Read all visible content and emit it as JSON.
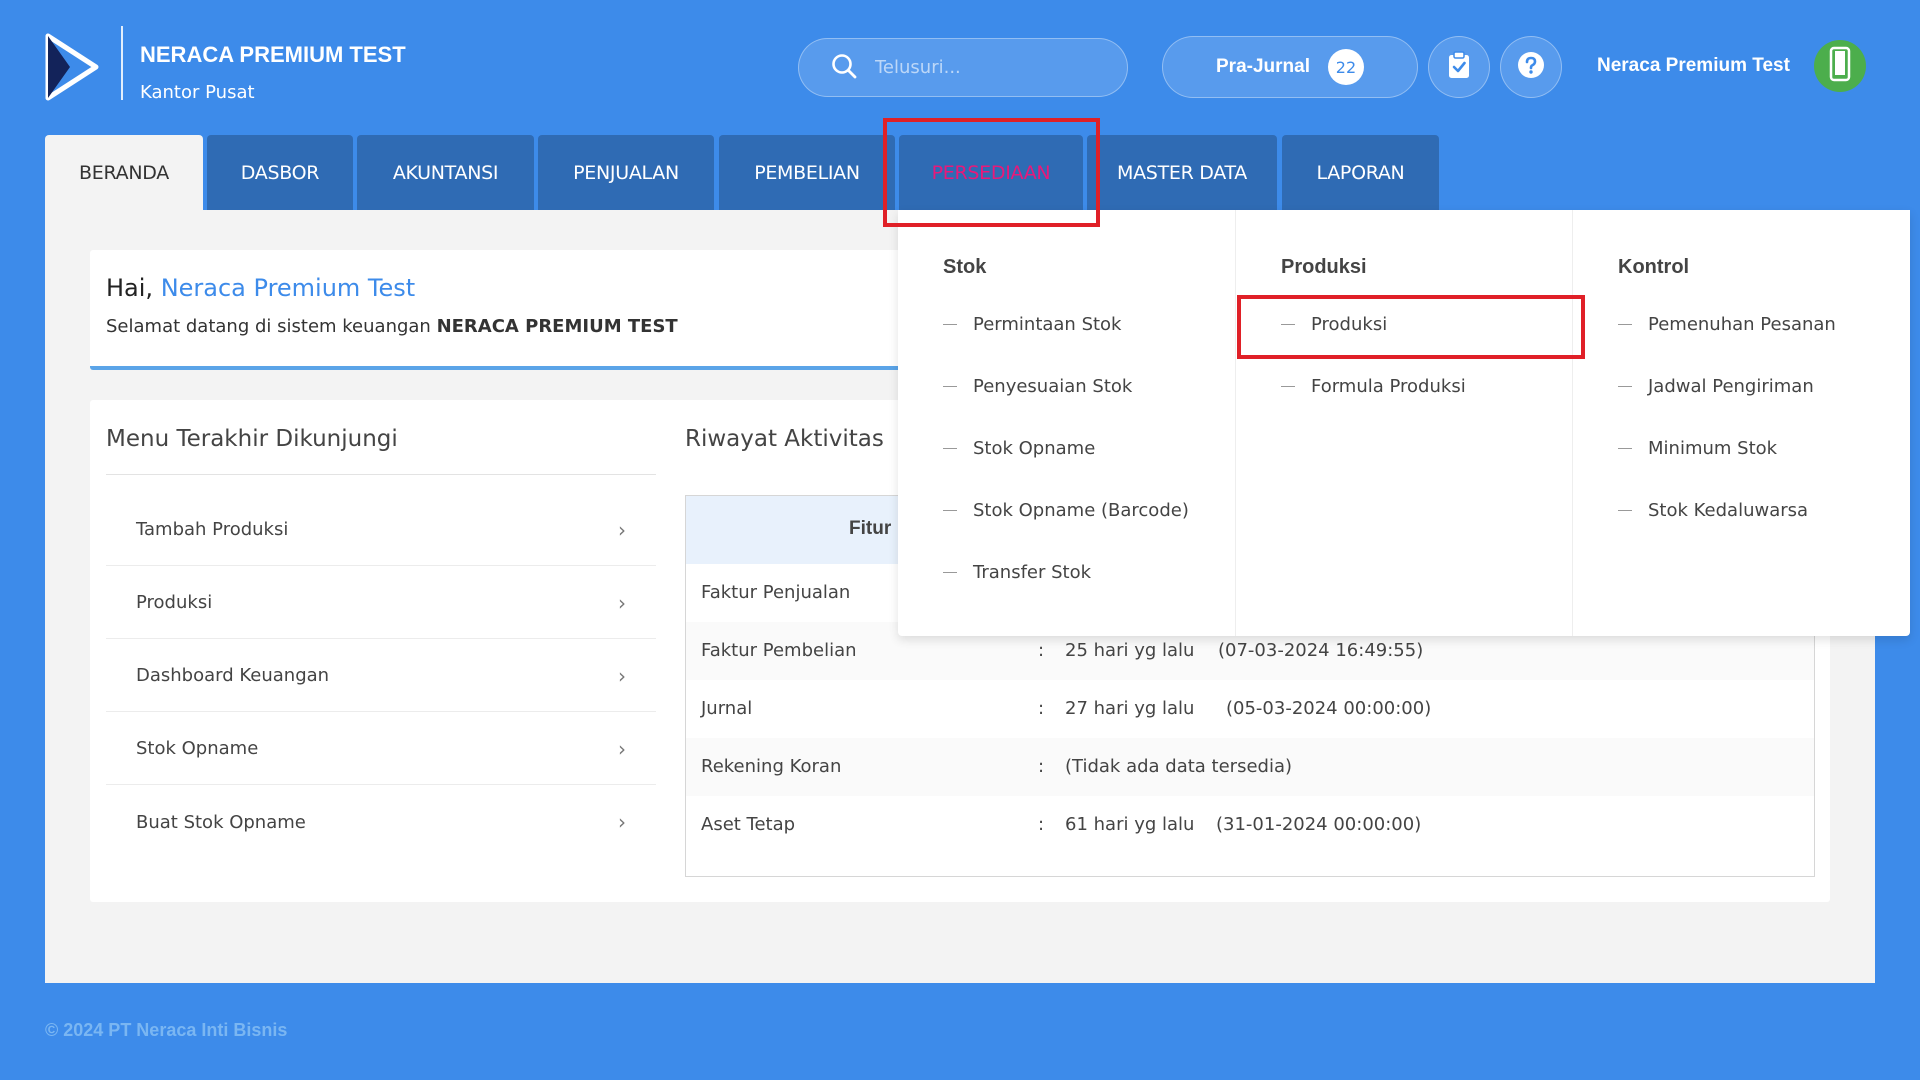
{
  "brand": {
    "title": "NERACA PREMIUM TEST",
    "subtitle": "Kantor Pusat"
  },
  "search": {
    "placeholder": "Telusuri..."
  },
  "prajurnal": {
    "label": "Pra-Jurnal",
    "count": "22"
  },
  "user": {
    "name": "Neraca Premium Test"
  },
  "tabs": [
    "BERANDA",
    "DASBOR",
    "AKUNTANSI",
    "PENJUALAN",
    "PEMBELIAN",
    "PERSEDIAAN",
    "MASTER DATA",
    "LAPORAN"
  ],
  "welcome": {
    "greeting": "Hai, ",
    "name": "Neraca Premium Test",
    "text": "Selamat datang di sistem keuangan ",
    "company": "NERACA PREMIUM TEST"
  },
  "recent": {
    "title": "Menu Terakhir Dikunjungi",
    "items": [
      "Tambah Produksi",
      "Produksi",
      "Dashboard Keuangan",
      "Stok Opname",
      "Buat Stok Opname"
    ]
  },
  "activity": {
    "title": "Riwayat Aktivitas",
    "header": "Fitur",
    "rows": [
      {
        "feature": "Faktur Penjualan",
        "sep": "",
        "ago": "",
        "date": ""
      },
      {
        "feature": "Faktur Pembelian",
        "sep": ":",
        "ago": "25 hari yg lalu",
        "date": "(07-03-2024 16:49:55)"
      },
      {
        "feature": "Jurnal",
        "sep": ":",
        "ago": "27 hari yg lalu",
        "date": "(05-03-2024 00:00:00)"
      },
      {
        "feature": "Rekening Koran",
        "sep": ":",
        "ago": "(Tidak ada data tersedia)",
        "date": ""
      },
      {
        "feature": "Aset Tetap",
        "sep": ":",
        "ago": "61 hari yg lalu",
        "date": "(31-01-2024 00:00:00)"
      }
    ]
  },
  "dropdown": {
    "stok": {
      "title": "Stok",
      "items": [
        "Permintaan Stok",
        "Penyesuaian Stok",
        "Stok Opname",
        "Stok Opname (Barcode)",
        "Transfer Stok"
      ]
    },
    "produksi": {
      "title": "Produksi",
      "items": [
        "Produksi",
        "Formula Produksi"
      ]
    },
    "kontrol": {
      "title": "Kontrol",
      "items": [
        "Pemenuhan Pesanan",
        "Jadwal Pengiriman",
        "Minimum Stok",
        "Stok Kedaluwarsa"
      ]
    }
  },
  "footer": "© 2024 PT Neraca Inti Bisnis",
  "colors": {
    "background": "#3d8bea",
    "tab": "#2f6bb4",
    "highlight": "#e8197a",
    "annotation": "#e02027"
  }
}
